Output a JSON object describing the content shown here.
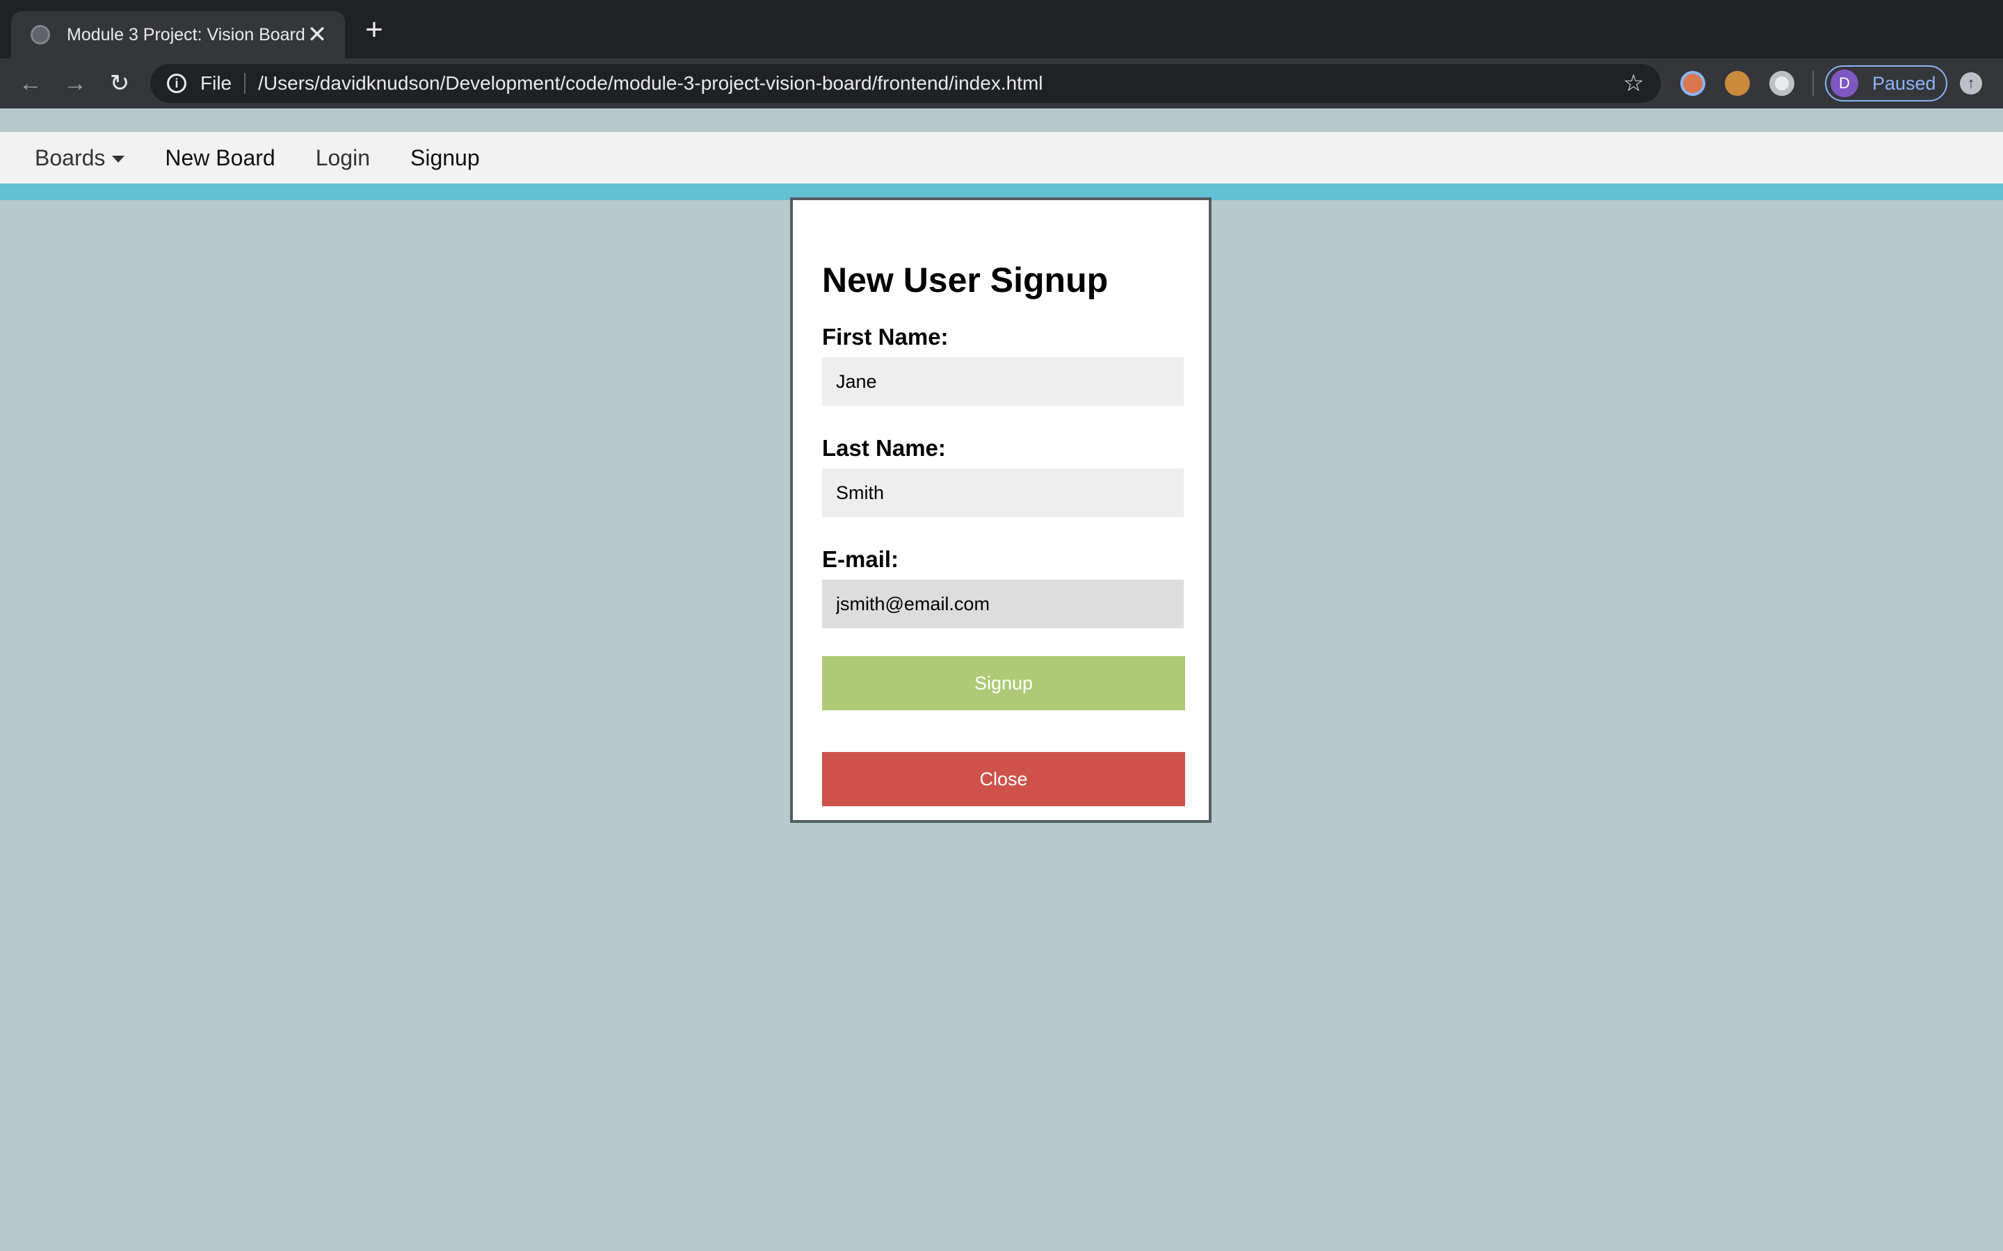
{
  "browser": {
    "tab": {
      "title": "Module 3 Project: Vision Board",
      "close_glyph": "✕"
    },
    "new_tab_glyph": "+",
    "toolbar": {
      "back_glyph": "←",
      "forward_glyph": "→",
      "reload_glyph": "↻",
      "info_glyph": "i",
      "scheme_label": "File",
      "url": "/Users/davidknudson/Development/code/module-3-project-vision-board/frontend/index.html",
      "star_glyph": "☆",
      "extensions": [
        "glasses-extension-icon",
        "cookie-extension-icon",
        "circle-extension-icon"
      ],
      "profile": {
        "initial": "D",
        "status": "Paused"
      },
      "update_glyph": "↑"
    }
  },
  "navbar": {
    "boards": "Boards",
    "new_board": "New Board",
    "login": "Login",
    "signup": "Signup"
  },
  "modal": {
    "title": "New User Signup",
    "fields": {
      "first_name": {
        "label": "First Name:",
        "value": "Jane"
      },
      "last_name": {
        "label": "Last Name:",
        "value": "Smith"
      },
      "email": {
        "label": "E-mail:",
        "value": "jsmith@email.com"
      }
    },
    "signup_label": "Signup",
    "close_label": "Close"
  },
  "colors": {
    "page_background": "#b7cbcd",
    "accent_bar": "#62c1d3",
    "signup_button": "#afca76",
    "close_button": "#ce524a",
    "browser_dark": "#202124",
    "profile_accent": "#8ab4f8"
  }
}
